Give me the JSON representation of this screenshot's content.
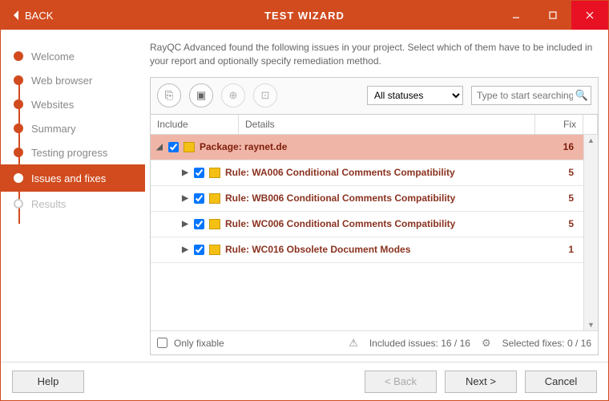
{
  "title": "TEST WIZARD",
  "back_label": "BACK",
  "steps": [
    {
      "label": "Welcome",
      "state": "done"
    },
    {
      "label": "Web browser",
      "state": "done"
    },
    {
      "label": "Websites",
      "state": "done"
    },
    {
      "label": "Summary",
      "state": "done"
    },
    {
      "label": "Testing progress",
      "state": "done"
    },
    {
      "label": "Issues and fixes",
      "state": "active"
    },
    {
      "label": "Results",
      "state": "future"
    }
  ],
  "intro": "RayQC Advanced found the following issues in your project. Select which of them have to be included in your report and optionally specify remediation method.",
  "toolbar_icons": [
    "include-all-icon",
    "picture-icon",
    "globe-icon",
    "package-icon"
  ],
  "status_filter": {
    "selected": "All statuses"
  },
  "search_placeholder": "Type to start searching...",
  "columns": {
    "include": "Include",
    "details": "Details",
    "fix": "Fix"
  },
  "package": {
    "label": "Package: raynet.de",
    "count": "16",
    "checked": true,
    "expanded": true
  },
  "rules": [
    {
      "label": "Rule: WA006 Conditional Comments Compatibility",
      "count": "5",
      "checked": true
    },
    {
      "label": "Rule: WB006 Conditional Comments Compatibility",
      "count": "5",
      "checked": true
    },
    {
      "label": "Rule: WC006 Conditional Comments Compatibility",
      "count": "5",
      "checked": true
    },
    {
      "label": "Rule: WC016 Obsolete Document Modes",
      "count": "1",
      "checked": true
    }
  ],
  "only_fixable_label": "Only fixable",
  "included_issues_label": "Included issues:  16 / 16",
  "selected_fixes_label": "Selected fixes:  0 / 16",
  "buttons": {
    "help": "Help",
    "back": "< Back",
    "next": "Next >",
    "cancel": "Cancel"
  }
}
